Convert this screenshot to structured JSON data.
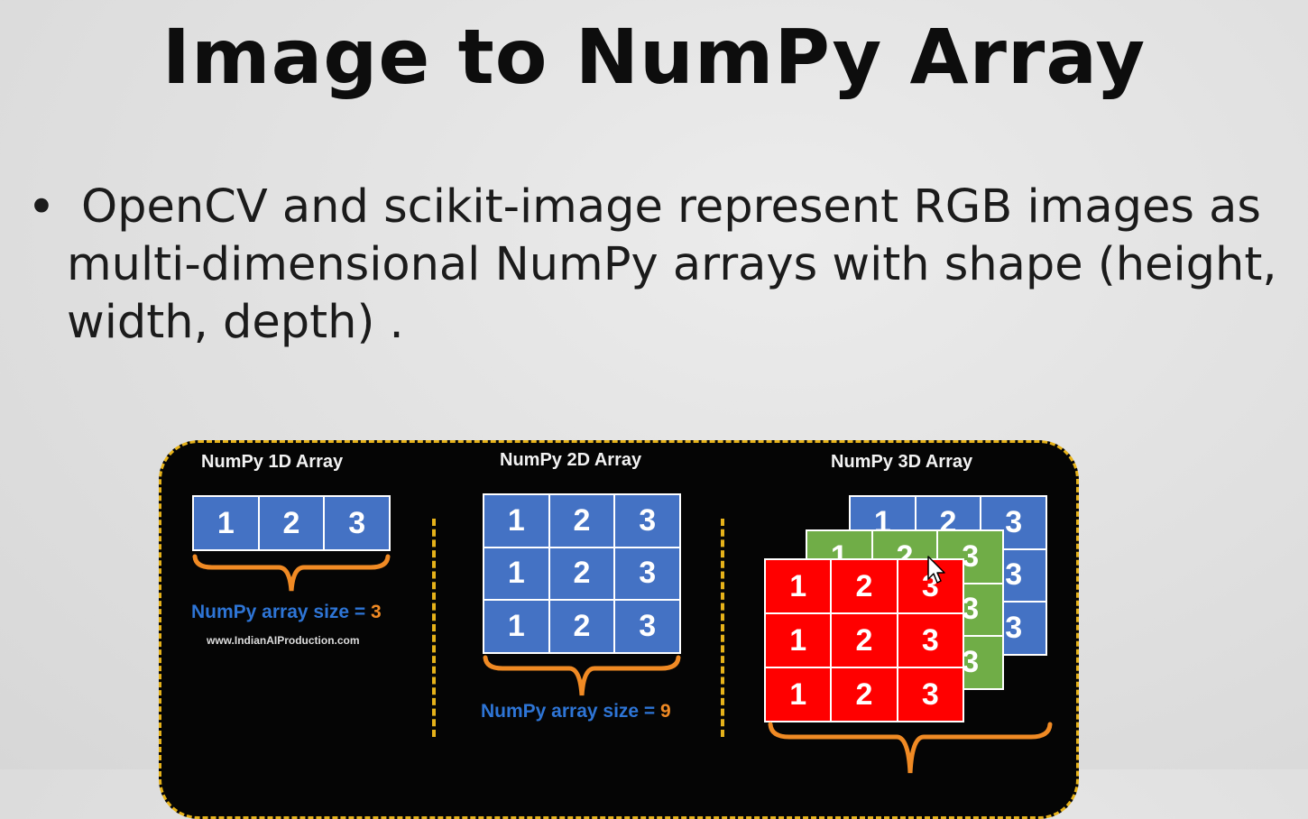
{
  "slide": {
    "title": "Image to NumPy Array",
    "bullet_symbol": "•",
    "bullet_text": "OpenCV and scikit-image represent RGB images as multi-dimensional NumPy arrays with shape (height, width, depth) ."
  },
  "diagram": {
    "section_1d": {
      "title": "NumPy 1D Array",
      "cells": [
        "1",
        "2",
        "3"
      ],
      "size_text": "NumPy array size = ",
      "size_value": "3",
      "watermark": "www.IndianAIProduction.com"
    },
    "section_2d": {
      "title": "NumPy 2D Array",
      "rows": [
        [
          "1",
          "2",
          "3"
        ],
        [
          "1",
          "2",
          "3"
        ],
        [
          "1",
          "2",
          "3"
        ]
      ],
      "size_text": "NumPy array size = ",
      "size_value": "9"
    },
    "section_3d": {
      "title": "NumPy 3D Array",
      "layers": [
        {
          "color": "blue",
          "rows": [
            [
              "1",
              "2",
              "3"
            ],
            [
              "1",
              "2",
              "3"
            ],
            [
              "1",
              "2",
              "3"
            ]
          ]
        },
        {
          "color": "green",
          "rows": [
            [
              "1",
              "2",
              "3"
            ],
            [
              "1",
              "2",
              "3"
            ],
            [
              "1",
              "2",
              "3"
            ]
          ]
        },
        {
          "color": "red",
          "rows": [
            [
              "1",
              "2",
              "3"
            ],
            [
              "1",
              "2",
              "3"
            ],
            [
              "1",
              "2",
              "3"
            ]
          ]
        }
      ]
    },
    "colors": {
      "border": "#e6b21a",
      "blue": "#4472c4",
      "green": "#70ad47",
      "red": "#ff0000",
      "size_label": "#2e75d6",
      "size_value": "#f08a24",
      "brace": "#f08a24"
    },
    "icons": [
      "mouse-cursor-icon"
    ]
  }
}
